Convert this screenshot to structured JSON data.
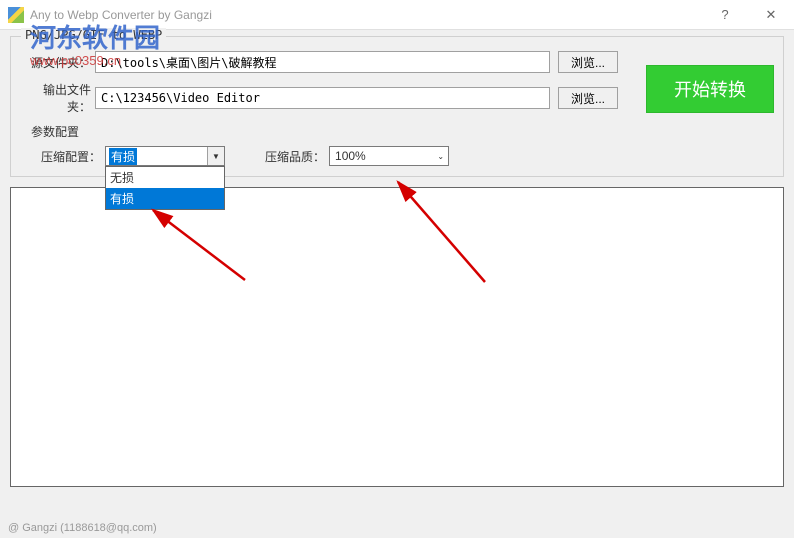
{
  "window": {
    "title": "Any to Webp Converter by Gangzi"
  },
  "group": {
    "title": "PNG/JPG/GIF to WEBP",
    "source_label": "源文件夹：",
    "source_path": "D:\\tools\\桌面\\图片\\破解教程",
    "output_label": "输出文件夹：",
    "output_path": "C:\\123456\\Video Editor",
    "browse_label": "浏览..."
  },
  "start_button": "开始转换",
  "params": {
    "section_label": "参数配置",
    "compress_label": "压缩配置：",
    "compress_value": "有损",
    "dropdown_options": [
      "无损",
      "有损"
    ],
    "quality_label": "压缩品质：",
    "quality_value": "100%"
  },
  "status": "@ Gangzi (1188618@qq.com)",
  "watermark": {
    "title": "河东软件园",
    "url": "www.pc0359.cn"
  }
}
